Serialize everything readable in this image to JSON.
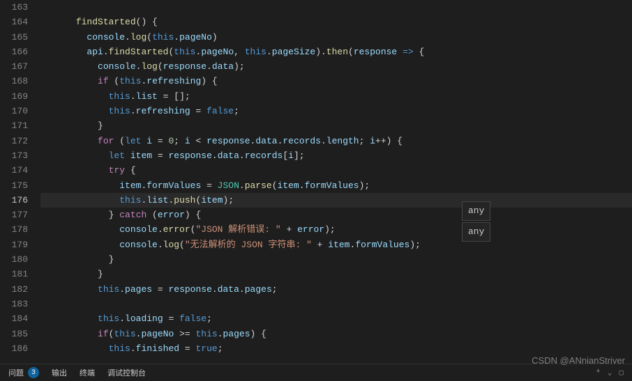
{
  "editor": {
    "startLine": 163,
    "currentLine": 176,
    "lines": [
      {
        "n": 163,
        "tokens": []
      },
      {
        "n": 164,
        "indent": 3,
        "tokens": [
          [
            "fn",
            "findStarted"
          ],
          [
            "punc",
            "() {"
          ]
        ]
      },
      {
        "n": 165,
        "indent": 4,
        "tokens": [
          [
            "var",
            "console"
          ],
          [
            "punc",
            "."
          ],
          [
            "fn",
            "log"
          ],
          [
            "punc",
            "("
          ],
          [
            "kw",
            "this"
          ],
          [
            "punc",
            "."
          ],
          [
            "prop",
            "pageNo"
          ],
          [
            "punc",
            ")"
          ]
        ]
      },
      {
        "n": 166,
        "indent": 4,
        "tokens": [
          [
            "var",
            "api"
          ],
          [
            "punc",
            "."
          ],
          [
            "fn",
            "findStarted"
          ],
          [
            "punc",
            "("
          ],
          [
            "kw",
            "this"
          ],
          [
            "punc",
            "."
          ],
          [
            "prop",
            "pageNo"
          ],
          [
            "punc",
            ", "
          ],
          [
            "kw",
            "this"
          ],
          [
            "punc",
            "."
          ],
          [
            "prop",
            "pageSize"
          ],
          [
            "punc",
            ")."
          ],
          [
            "fn",
            "then"
          ],
          [
            "punc",
            "("
          ],
          [
            "var",
            "response"
          ],
          [
            "punc",
            " "
          ],
          [
            "kw",
            "=>"
          ],
          [
            "punc",
            " {"
          ]
        ]
      },
      {
        "n": 167,
        "indent": 5,
        "tokens": [
          [
            "var",
            "console"
          ],
          [
            "punc",
            "."
          ],
          [
            "fn",
            "log"
          ],
          [
            "punc",
            "("
          ],
          [
            "var",
            "response"
          ],
          [
            "punc",
            "."
          ],
          [
            "prop",
            "data"
          ],
          [
            "punc",
            ");"
          ]
        ]
      },
      {
        "n": 168,
        "indent": 5,
        "tokens": [
          [
            "ctrl",
            "if"
          ],
          [
            "punc",
            " ("
          ],
          [
            "kw",
            "this"
          ],
          [
            "punc",
            "."
          ],
          [
            "prop",
            "refreshing"
          ],
          [
            "punc",
            ") {"
          ]
        ]
      },
      {
        "n": 169,
        "indent": 6,
        "tokens": [
          [
            "kw",
            "this"
          ],
          [
            "punc",
            "."
          ],
          [
            "prop",
            "list"
          ],
          [
            "punc",
            " = [];"
          ]
        ]
      },
      {
        "n": 170,
        "indent": 6,
        "tokens": [
          [
            "kw",
            "this"
          ],
          [
            "punc",
            "."
          ],
          [
            "prop",
            "refreshing"
          ],
          [
            "punc",
            " = "
          ],
          [
            "const",
            "false"
          ],
          [
            "punc",
            ";"
          ]
        ]
      },
      {
        "n": 171,
        "indent": 5,
        "tokens": [
          [
            "punc",
            "}"
          ]
        ]
      },
      {
        "n": 172,
        "indent": 5,
        "tokens": [
          [
            "ctrl",
            "for"
          ],
          [
            "punc",
            " ("
          ],
          [
            "kw",
            "let"
          ],
          [
            "punc",
            " "
          ],
          [
            "var",
            "i"
          ],
          [
            "punc",
            " = "
          ],
          [
            "num",
            "0"
          ],
          [
            "punc",
            "; "
          ],
          [
            "var",
            "i"
          ],
          [
            "punc",
            " < "
          ],
          [
            "var",
            "response"
          ],
          [
            "punc",
            "."
          ],
          [
            "prop",
            "data"
          ],
          [
            "punc",
            "."
          ],
          [
            "prop",
            "records"
          ],
          [
            "punc",
            "."
          ],
          [
            "prop",
            "length"
          ],
          [
            "punc",
            "; "
          ],
          [
            "var",
            "i"
          ],
          [
            "punc",
            "++) {"
          ]
        ]
      },
      {
        "n": 173,
        "indent": 6,
        "tokens": [
          [
            "kw",
            "let"
          ],
          [
            "punc",
            " "
          ],
          [
            "var",
            "item"
          ],
          [
            "punc",
            " = "
          ],
          [
            "var",
            "response"
          ],
          [
            "punc",
            "."
          ],
          [
            "prop",
            "data"
          ],
          [
            "punc",
            "."
          ],
          [
            "prop",
            "records"
          ],
          [
            "punc",
            "["
          ],
          [
            "var",
            "i"
          ],
          [
            "punc",
            "];"
          ]
        ]
      },
      {
        "n": 174,
        "indent": 6,
        "tokens": [
          [
            "ctrl",
            "try"
          ],
          [
            "punc",
            " {"
          ]
        ]
      },
      {
        "n": 175,
        "indent": 7,
        "tokens": [
          [
            "var",
            "item"
          ],
          [
            "punc",
            "."
          ],
          [
            "prop",
            "formValues"
          ],
          [
            "punc",
            " = "
          ],
          [
            "obj",
            "JSON"
          ],
          [
            "punc",
            "."
          ],
          [
            "fn",
            "parse"
          ],
          [
            "punc",
            "("
          ],
          [
            "var",
            "item"
          ],
          [
            "punc",
            "."
          ],
          [
            "prop",
            "formValues"
          ],
          [
            "punc",
            ");"
          ]
        ]
      },
      {
        "n": 176,
        "indent": 7,
        "tokens": [
          [
            "kw",
            "this"
          ],
          [
            "punc",
            "."
          ],
          [
            "prop",
            "list"
          ],
          [
            "punc",
            "."
          ],
          [
            "fn",
            "push"
          ],
          [
            "punc",
            "("
          ],
          [
            "var",
            "item"
          ],
          [
            "punc",
            ");"
          ]
        ]
      },
      {
        "n": 177,
        "indent": 6,
        "tokens": [
          [
            "punc",
            "} "
          ],
          [
            "ctrl",
            "catch"
          ],
          [
            "punc",
            " ("
          ],
          [
            "var",
            "error"
          ],
          [
            "punc",
            ") {"
          ]
        ]
      },
      {
        "n": 178,
        "indent": 7,
        "tokens": [
          [
            "var",
            "console"
          ],
          [
            "punc",
            "."
          ],
          [
            "fn",
            "error"
          ],
          [
            "punc",
            "("
          ],
          [
            "str",
            "\"JSON 解析错误: \""
          ],
          [
            "punc",
            " + "
          ],
          [
            "var",
            "error"
          ],
          [
            "punc",
            ");"
          ]
        ]
      },
      {
        "n": 179,
        "indent": 7,
        "tokens": [
          [
            "var",
            "console"
          ],
          [
            "punc",
            "."
          ],
          [
            "fn",
            "log"
          ],
          [
            "punc",
            "("
          ],
          [
            "str",
            "\"无法解析的 JSON 字符串: \""
          ],
          [
            "punc",
            " + "
          ],
          [
            "var",
            "item"
          ],
          [
            "punc",
            "."
          ],
          [
            "prop",
            "formValues"
          ],
          [
            "punc",
            ");"
          ]
        ]
      },
      {
        "n": 180,
        "indent": 6,
        "tokens": [
          [
            "punc",
            "}"
          ]
        ]
      },
      {
        "n": 181,
        "indent": 5,
        "tokens": [
          [
            "punc",
            "}"
          ]
        ]
      },
      {
        "n": 182,
        "indent": 5,
        "tokens": [
          [
            "kw",
            "this"
          ],
          [
            "punc",
            "."
          ],
          [
            "prop",
            "pages"
          ],
          [
            "punc",
            " = "
          ],
          [
            "var",
            "response"
          ],
          [
            "punc",
            "."
          ],
          [
            "prop",
            "data"
          ],
          [
            "punc",
            "."
          ],
          [
            "prop",
            "pages"
          ],
          [
            "punc",
            ";"
          ]
        ]
      },
      {
        "n": 183,
        "indent": 0,
        "tokens": []
      },
      {
        "n": 184,
        "indent": 5,
        "tokens": [
          [
            "kw",
            "this"
          ],
          [
            "punc",
            "."
          ],
          [
            "prop",
            "loading"
          ],
          [
            "punc",
            " = "
          ],
          [
            "const",
            "false"
          ],
          [
            "punc",
            ";"
          ]
        ]
      },
      {
        "n": 185,
        "indent": 5,
        "tokens": [
          [
            "ctrl",
            "if"
          ],
          [
            "punc",
            "("
          ],
          [
            "kw",
            "this"
          ],
          [
            "punc",
            "."
          ],
          [
            "prop",
            "pageNo"
          ],
          [
            "punc",
            " >= "
          ],
          [
            "kw",
            "this"
          ],
          [
            "punc",
            "."
          ],
          [
            "prop",
            "pages"
          ],
          [
            "punc",
            ") {"
          ]
        ]
      },
      {
        "n": 186,
        "indent": 6,
        "tokens": [
          [
            "kw",
            "this"
          ],
          [
            "punc",
            "."
          ],
          [
            "prop",
            "finished"
          ],
          [
            "punc",
            " = "
          ],
          [
            "const",
            "true"
          ],
          [
            "punc",
            ";"
          ]
        ]
      }
    ]
  },
  "hover": {
    "tip1": "any",
    "tip2": "any"
  },
  "panel": {
    "tabs": {
      "problems": "问题",
      "problemsCount": "3",
      "output": "输出",
      "terminal": "终端",
      "debugConsole": "调试控制台"
    }
  },
  "watermark": "CSDN @ANnianStriver"
}
